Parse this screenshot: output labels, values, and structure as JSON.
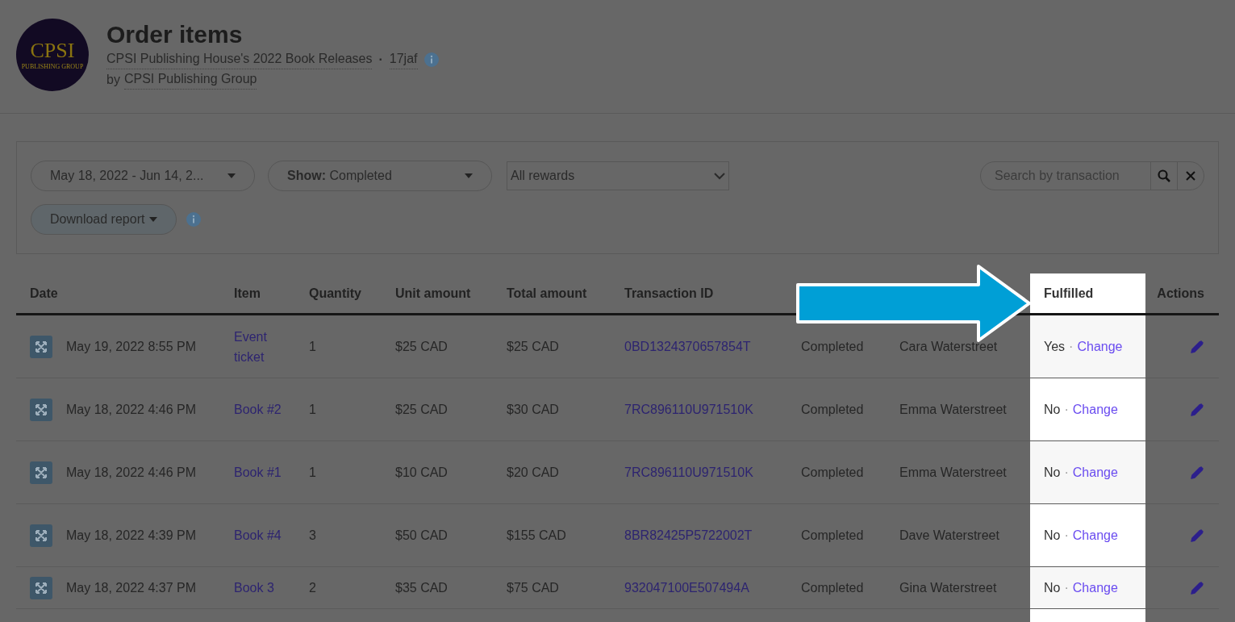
{
  "header": {
    "logo": {
      "name": "CPSI",
      "tagline": "PUBLISHING GROUP"
    },
    "title": "Order items",
    "project": "CPSI Publishing House's 2022 Book Releases",
    "separator": "·",
    "code": "17jaf",
    "byline_prefix": "by",
    "creator": "CPSI Publishing Group"
  },
  "filters": {
    "date_range": "May 18, 2022 - Jun 14, 2...",
    "show_label": "Show:",
    "show_value": "Completed",
    "rewards": "All rewards",
    "search_placeholder": "Search by transaction",
    "download": "Download report"
  },
  "table": {
    "columns": [
      {
        "label": "Date",
        "highlighted": false
      },
      {
        "label": "Item",
        "highlighted": false
      },
      {
        "label": "Quantity",
        "highlighted": false
      },
      {
        "label": "Unit amount",
        "highlighted": false
      },
      {
        "label": "Total amount",
        "highlighted": false
      },
      {
        "label": "Transaction ID",
        "highlighted": false
      },
      {
        "highlighted": false
      },
      {
        "highlighted": false
      },
      {
        "label": "Fulfilled",
        "highlighted": true
      },
      {
        "label": "Actions",
        "highlighted": false
      }
    ],
    "rows": [
      {
        "date": "May 19, 2022 8:55 PM",
        "item": "Event ticket",
        "quantity": "1",
        "unit_amount": "$25 CAD",
        "total_amount": "$25 CAD",
        "transaction_id": "0BD1324370657854T",
        "column_7": "Completed",
        "column_8": "Cara Waterstreet",
        "fulfilled": "Yes",
        "separator": "·",
        "change": "Change"
      },
      {
        "date": "May 18, 2022 4:46 PM",
        "item": "Book #2",
        "quantity": "1",
        "unit_amount": "$25 CAD",
        "total_amount": "$30 CAD",
        "transaction_id": "7RC896110U971510K",
        "column_7": "Completed",
        "column_8": "Emma Waterstreet",
        "fulfilled": "No",
        "separator": "·",
        "change": "Change"
      },
      {
        "date": "May 18, 2022 4:46 PM",
        "item": "Book #1",
        "quantity": "1",
        "unit_amount": "$10 CAD",
        "total_amount": "$20 CAD",
        "transaction_id": "7RC896110U971510K",
        "column_7": "Completed",
        "column_8": "Emma Waterstreet",
        "fulfilled": "No",
        "separator": "·",
        "change": "Change"
      },
      {
        "date": "May 18, 2022 4:39 PM",
        "item": "Book #4",
        "quantity": "3",
        "unit_amount": "$50 CAD",
        "total_amount": "$155 CAD",
        "transaction_id": "8BR82425P5722002T",
        "column_7": "Completed",
        "column_8": "Dave Waterstreet",
        "fulfilled": "No",
        "separator": "·",
        "change": "Change"
      },
      {
        "date": "May 18, 2022 4:37 PM",
        "item": "Book 3",
        "quantity": "2",
        "unit_amount": "$35 CAD",
        "total_amount": "$75 CAD",
        "transaction_id": "932047100E507494A",
        "column_7": "Completed",
        "column_8": "Gina Waterstreet",
        "fulfilled": "No",
        "separator": "·",
        "change": "Change"
      }
    ]
  }
}
